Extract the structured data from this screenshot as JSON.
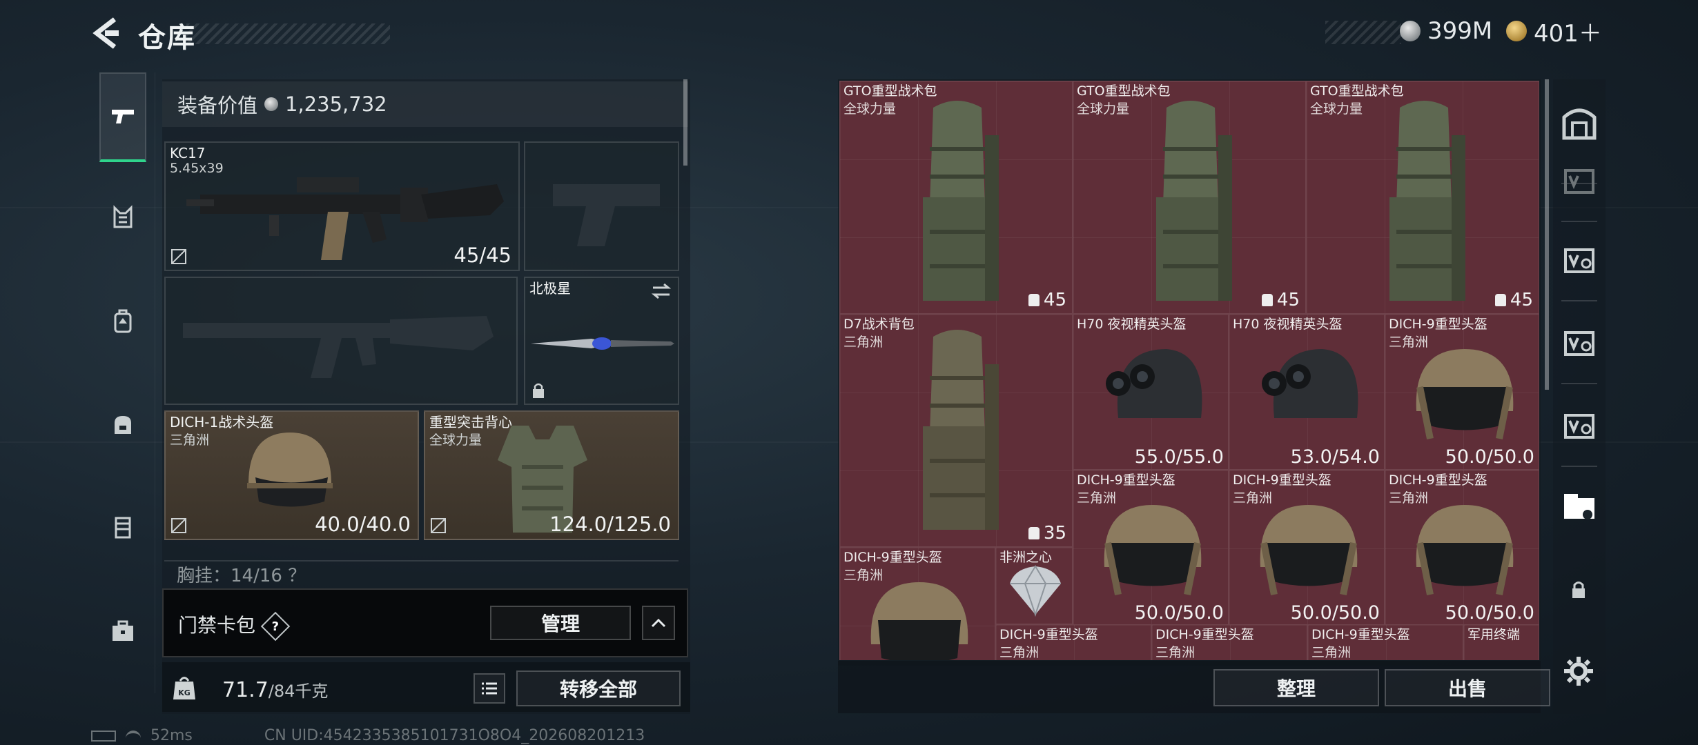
{
  "header": {
    "title": "仓库"
  },
  "currency": {
    "silver": "399M",
    "gold": "401＋"
  },
  "equipment": {
    "value_label": "装备价值",
    "value": "1,235,732",
    "primary": {
      "name": "KC17",
      "ammo": "5.45x39",
      "count": "45/45"
    },
    "melee": {
      "name": "北极星"
    },
    "helmet": {
      "name": "DICH-1战术头盔",
      "sub": "三角洲",
      "durability": "40.0/40.0"
    },
    "armor": {
      "name": "重型突击背心",
      "sub": "全球力量",
      "durability": "124.0/125.0"
    },
    "chest_rig": "胸挂：14/16 ？",
    "keycard_label": "门禁卡包",
    "keycard_help": "?",
    "manage_button": "管理",
    "weight_value": "71.7",
    "weight_max": "/84千克",
    "transfer_all": "转移全部"
  },
  "stash": {
    "items": [
      {
        "name": "GTO重型战术包",
        "sub": "全球力量",
        "qty": "45"
      },
      {
        "name": "GTO重型战术包",
        "sub": "全球力量",
        "qty": "45"
      },
      {
        "name": "GTO重型战术包",
        "sub": "全球力量",
        "qty": "45"
      },
      {
        "name": "D7战术背包",
        "sub": "三角洲",
        "qty": "35"
      },
      {
        "name": "H70 夜视精英头盔",
        "sub": "",
        "durability": "55.0/55.0"
      },
      {
        "name": "H70 夜视精英头盔",
        "sub": "",
        "durability": "53.0/54.0"
      },
      {
        "name": "DICH-9重型头盔",
        "sub": "三角洲",
        "durability": "50.0/50.0"
      },
      {
        "name": "DICH-9重型头盔",
        "sub": "三角洲",
        "durability": "50.0/50.0"
      },
      {
        "name": "DICH-9重型头盔",
        "sub": "三角洲",
        "durability": "50.0/50.0"
      },
      {
        "name": "DICH-9重型头盔",
        "sub": "三角洲",
        "durability": "50.0/50.0"
      },
      {
        "name": "DICH-9重型头盔",
        "sub": "三角洲"
      },
      {
        "name": "非洲之心",
        "sub": ""
      },
      {
        "name": "DICH-9重型头盔",
        "sub": "三角洲"
      },
      {
        "name": "DICH-9重型头盔",
        "sub": "三角洲"
      },
      {
        "name": "DICH-9重型头盔",
        "sub": "三角洲"
      },
      {
        "name": "军用终端",
        "sub": ""
      }
    ],
    "sort_button": "整理",
    "sell_button": "出售"
  },
  "status": {
    "ping": "52ms",
    "uid": "CN UID:4542335385101731O8O4_202608201213"
  },
  "colors": {
    "accent": "#2fd48c",
    "stash_bg": "#5f2e38",
    "equip_brown": "#4a4035"
  }
}
